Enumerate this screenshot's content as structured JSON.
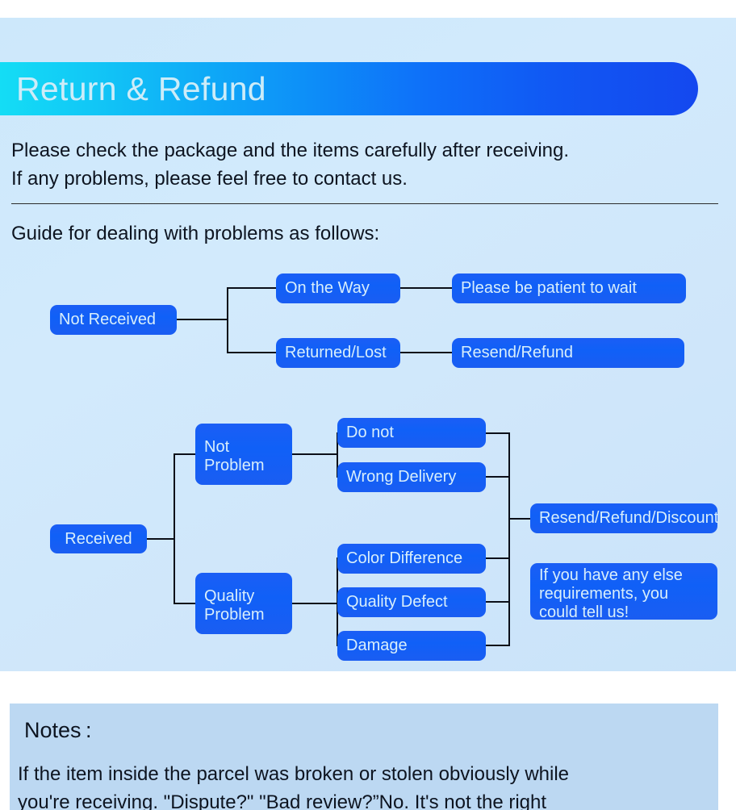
{
  "header": {
    "title": "Return & Refund",
    "gradient_start": "#14ddf5",
    "gradient_end": "#1448ef"
  },
  "intro": {
    "line1": "Please check the package and the items carefully after receiving.",
    "line2": "If any problems, please feel free to contact us."
  },
  "guide_heading": "Guide for dealing with problems as follows:",
  "colors": {
    "panel_background": "#cfe6fa",
    "node_blue": "#1060f7",
    "node_text": "#d8eefb",
    "connector": "#0b0f18",
    "notes_background": "#bcd8f2"
  },
  "flow_not_received": {
    "root": "Not Received",
    "branch_1": "On the Way",
    "branch_1_result": "Please be patient to wait",
    "branch_2": "Returned/Lost",
    "branch_2_result": "Resend/Refund"
  },
  "flow_received": {
    "root": "Received",
    "category_1": "Not\nProblem",
    "category_1_line1": "Not",
    "category_1_line2": "Problem",
    "category_2_line1": "Quality",
    "category_2_line2": "Problem",
    "items_not_problem": [
      "Do not",
      "Wrong Delivery"
    ],
    "items_quality_problem": [
      "Color Difference",
      "Quality Defect",
      "Damage"
    ],
    "result_1": "Resend/Refund/Discount",
    "result_2_line1": "If you have any else",
    "result_2_line2": "requirements, you",
    "result_2_line3": "could tell us!"
  },
  "notes": {
    "title": "Notes :",
    "line1": "If the item inside the parcel was broken or stolen obviously while",
    "line2": "you're receiving. \"Dispute?\" \"Bad review?”No. It's not the right"
  }
}
